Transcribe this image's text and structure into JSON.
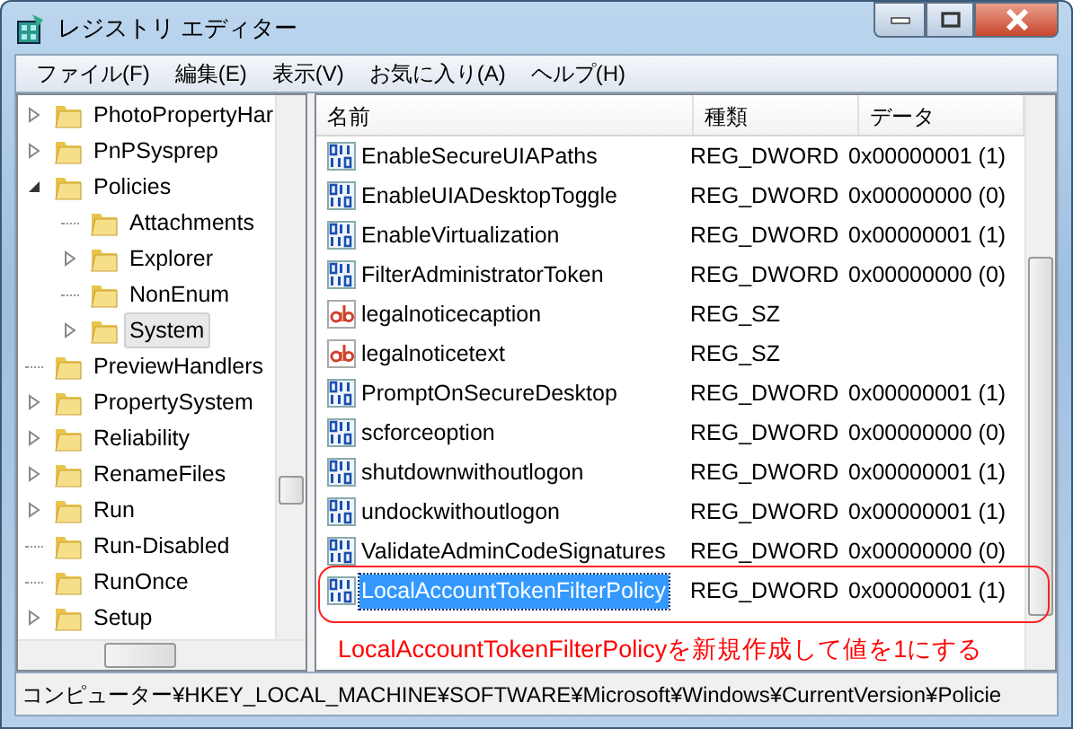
{
  "window": {
    "title": "レジストリ エディター"
  },
  "menu": [
    "ファイル(F)",
    "編集(E)",
    "表示(V)",
    "お気に入り(A)",
    "ヘルプ(H)"
  ],
  "tree": [
    {
      "label": "PhotoPropertyHar",
      "expanded": false,
      "selected": false
    },
    {
      "label": "PnPSysprep",
      "expanded": false,
      "selected": false
    },
    {
      "label": "Policies",
      "expanded": true,
      "selected": false,
      "children": [
        {
          "label": "Attachments",
          "selected": false
        },
        {
          "label": "Explorer",
          "expanded": false,
          "selected": false
        },
        {
          "label": "NonEnum",
          "selected": false
        },
        {
          "label": "System",
          "expanded": false,
          "selected": true
        }
      ]
    },
    {
      "label": "PreviewHandlers",
      "selected": false
    },
    {
      "label": "PropertySystem",
      "expanded": false,
      "selected": false
    },
    {
      "label": "Reliability",
      "expanded": false,
      "selected": false
    },
    {
      "label": "RenameFiles",
      "expanded": false,
      "selected": false
    },
    {
      "label": "Run",
      "expanded": false,
      "selected": false
    },
    {
      "label": "Run-Disabled",
      "selected": false
    },
    {
      "label": "RunOnce",
      "selected": false
    },
    {
      "label": "Setup",
      "expanded": false,
      "selected": false
    }
  ],
  "table": {
    "columns": [
      "名前",
      "種類",
      "データ"
    ],
    "rows": [
      {
        "kind": "dword",
        "name": "EnableSecureUIAPaths",
        "type": "REG_DWORD",
        "data": "0x00000001 (1)",
        "selected": false
      },
      {
        "kind": "dword",
        "name": "EnableUIADesktopToggle",
        "type": "REG_DWORD",
        "data": "0x00000000 (0)",
        "selected": false
      },
      {
        "kind": "dword",
        "name": "EnableVirtualization",
        "type": "REG_DWORD",
        "data": "0x00000001 (1)",
        "selected": false
      },
      {
        "kind": "dword",
        "name": "FilterAdministratorToken",
        "type": "REG_DWORD",
        "data": "0x00000000 (0)",
        "selected": false
      },
      {
        "kind": "sz",
        "name": "legalnoticecaption",
        "type": "REG_SZ",
        "selected": false
      },
      {
        "kind": "sz",
        "name": "legalnoticetext",
        "type": "REG_SZ",
        "selected": false
      },
      {
        "kind": "dword",
        "name": "PromptOnSecureDesktop",
        "type": "REG_DWORD",
        "data": "0x00000001 (1)",
        "selected": false
      },
      {
        "kind": "dword",
        "name": "scforceoption",
        "type": "REG_DWORD",
        "data": "0x00000000 (0)",
        "selected": false
      },
      {
        "kind": "dword",
        "name": "shutdownwithoutlogon",
        "type": "REG_DWORD",
        "data": "0x00000001 (1)",
        "selected": false
      },
      {
        "kind": "dword",
        "name": "undockwithoutlogon",
        "type": "REG_DWORD",
        "data": "0x00000001 (1)",
        "selected": false
      },
      {
        "kind": "dword",
        "name": "ValidateAdminCodeSignatures",
        "type": "REG_DWORD",
        "data": "0x00000000 (0)",
        "selected": false
      },
      {
        "kind": "dword",
        "name": "LocalAccountTokenFilterPolicy",
        "type": "REG_DWORD",
        "data": "0x00000001 (1)",
        "selected": true
      }
    ]
  },
  "annotation": {
    "text": "LocalAccountTokenFilterPolicyを新規作成して値を1にする"
  },
  "status_bar": "コンピューター¥HKEY_LOCAL_MACHINE¥SOFTWARE¥Microsoft¥Windows¥CurrentVersion¥Policie"
}
